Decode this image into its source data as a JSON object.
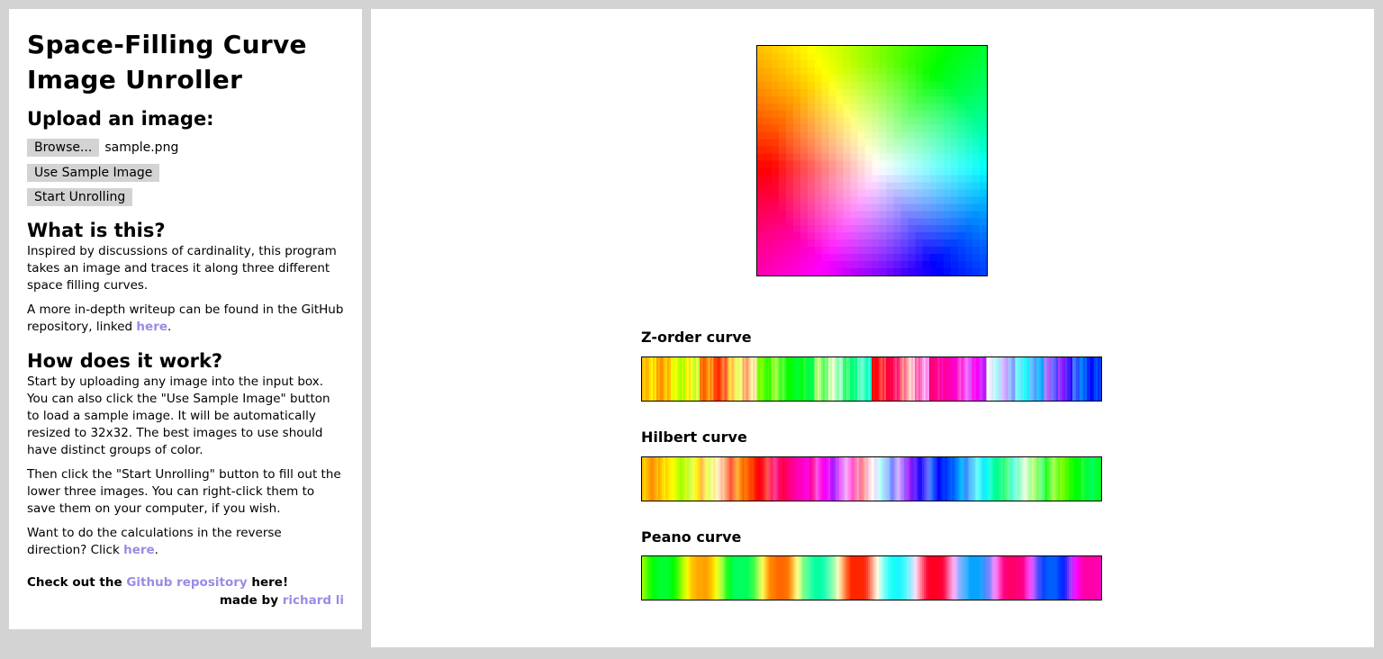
{
  "sidebar": {
    "title_line1": "Space-Filling Curve",
    "title_line2": "Image Unroller",
    "upload_heading": "Upload an image:",
    "browse_label": "Browse...",
    "file_name": "sample.png",
    "sample_button": "Use Sample Image",
    "start_button": "Start Unrolling",
    "what_heading": "What is this?",
    "what_p1": "Inspired by discussions of cardinality, this program takes an image and traces it along three different space filling curves.",
    "what_p2_pre": "A more in-depth writeup can be found in the GitHub repository, linked ",
    "what_p2_link": "here",
    "what_p2_post": ".",
    "how_heading": "How does it work?",
    "how_p1": "Start by uploading any image into the input box. You can also click the \"Use Sample Image\" button to load a sample image. It will be automatically resized to 32x32. The best images to use should have distinct groups of color.",
    "how_p2": "Then click the \"Start Unrolling\" button to fill out the lower three images. You can right-click them to save them on your computer, if you wish.",
    "how_p3_pre": "Want to do the calculations in the reverse direction? Click ",
    "how_p3_link": "here",
    "how_p3_post": ".",
    "check_pre": "Check out the ",
    "check_link": "Github repository",
    "check_post": " here!",
    "made_pre": "made by ",
    "made_link": "richard li"
  },
  "main": {
    "curves": [
      {
        "title": "Z-order curve"
      },
      {
        "title": "Hilbert curve"
      },
      {
        "title": "Peano curve"
      }
    ]
  },
  "colors": {
    "background": "#d3d3d3",
    "link": "#9a8ce4",
    "button": "#d3d3d3"
  }
}
